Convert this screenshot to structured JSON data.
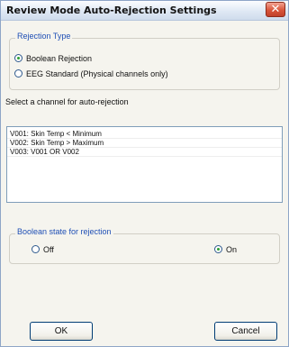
{
  "window": {
    "title": "Review Mode Auto-Rejection Settings",
    "close_glyph": "✕",
    "close_icon": "close-icon"
  },
  "rejection_type": {
    "legend": "Rejection Type",
    "selected": "boolean",
    "options": [
      {
        "id": "boolean",
        "label": "Boolean Rejection",
        "checked": true
      },
      {
        "id": "eeg",
        "label": "EEG Standard (Physical channels only)",
        "checked": false
      }
    ]
  },
  "channel_select": {
    "prompt": "Select a channel for auto-rejection",
    "items": [
      "V001: Skin Temp < Minimum",
      "V002: Skin Temp > Maximum",
      "V003: V001 OR V002"
    ]
  },
  "boolean_state": {
    "legend": "Boolean state for rejection",
    "selected": "on",
    "options": [
      {
        "id": "off",
        "label": "Off",
        "checked": false
      },
      {
        "id": "on",
        "label": "On",
        "checked": true
      }
    ]
  },
  "buttons": {
    "ok": "OK",
    "cancel": "Cancel"
  },
  "colors": {
    "accent": "#1f4fb5",
    "radio_dot": "#2ca035",
    "close_button": "#d9553a"
  }
}
